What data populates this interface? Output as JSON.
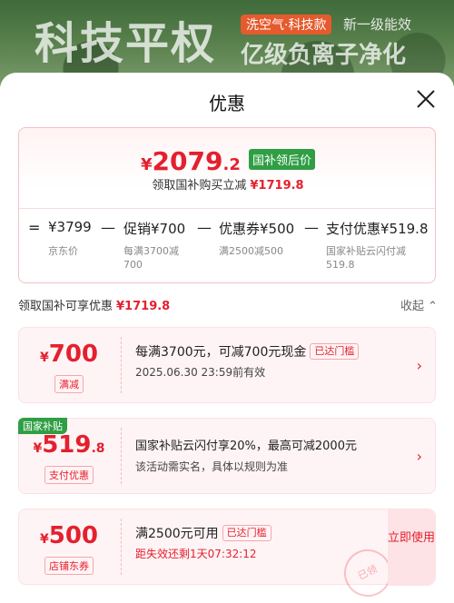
{
  "banner": {
    "headline": "科技平权",
    "tag": "洗空气·科技款",
    "tag2": "新一级能效",
    "sub": "亿级负离子净化"
  },
  "sheet": {
    "title": "优惠"
  },
  "price_card": {
    "yen": "¥",
    "final_int": "2079",
    "final_dec": ".2",
    "badge": "国补领后价",
    "sub_text": "领取国补购买立减",
    "sub_amount": "¥1719.8",
    "breakdown": [
      {
        "op": "=",
        "value": "¥3799",
        "note": "京东价"
      },
      {
        "op": "—",
        "value": "促销¥700",
        "note": "每满3700减\n700"
      },
      {
        "op": "—",
        "value": "优惠券¥500",
        "note": "满2500减500"
      },
      {
        "op": "—",
        "value": "支付优惠¥519.8",
        "note": "国家补贴云闪付减\n519.8"
      }
    ]
  },
  "section": {
    "label": "领取国补可享优惠",
    "amount": "¥1719.8",
    "collapse": "收起"
  },
  "coupons": [
    {
      "yen": "¥",
      "value": "700",
      "dec": "",
      "label": "满减",
      "title": "每满3700元，可减700元现金",
      "status": "已达门槛",
      "line2": "2025.06.30 23:59前有效"
    },
    {
      "tag": "国家补贴",
      "yen": "¥",
      "value": "519",
      "dec": ".8",
      "label": "支付优惠",
      "title": "国家补贴云闪付享20%，最高可减2000元",
      "line2": "该活动需实名，具体以规则为准"
    },
    {
      "yen": "¥",
      "value": "500",
      "dec": "",
      "label": "店铺东券",
      "title": "满2500元可用",
      "status": "已达门槛",
      "line2": "距失效还剩1天07:32:12",
      "button": "立即使用",
      "stamp": "已领"
    }
  ],
  "colors": {
    "accent": "#e4202e",
    "green": "#2f9e44"
  }
}
